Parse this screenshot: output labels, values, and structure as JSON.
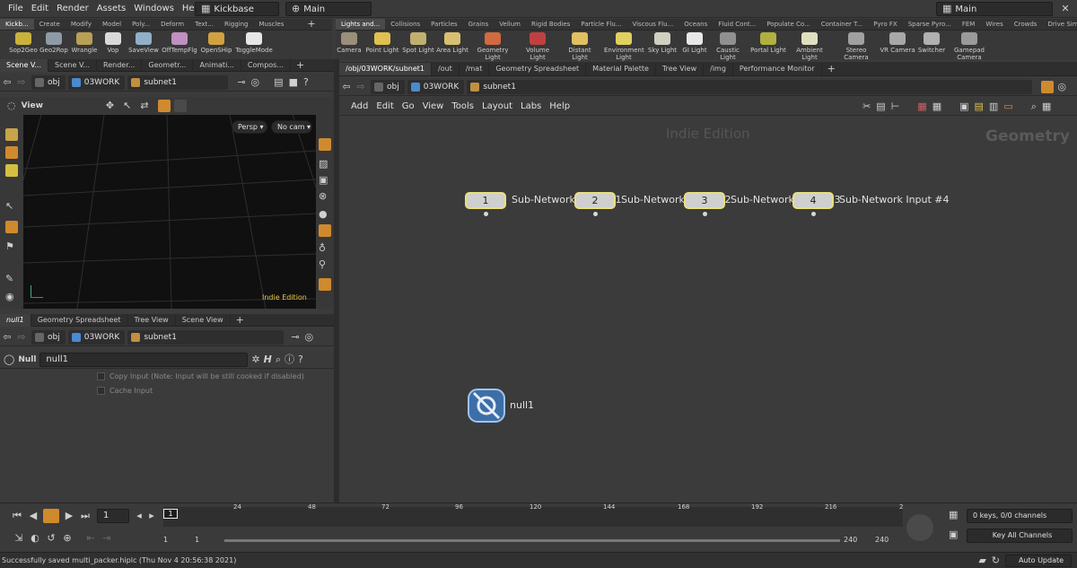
{
  "menubar": {
    "items": [
      "File",
      "Edit",
      "Render",
      "Assets",
      "Windows",
      "Help"
    ],
    "desktop_combo": "Kickbase",
    "context_combo": "Main",
    "right_combo": "Main"
  },
  "left_shelf": {
    "tabs": [
      "Kickb...",
      "Create",
      "Modify",
      "Model",
      "Poly...",
      "Deform",
      "Text...",
      "Rigging",
      "Muscles"
    ],
    "tools": [
      "Sop2Geo",
      "Geo2Rop",
      "Wrangle",
      "Vop",
      "SaveView",
      "OffTempFlg",
      "OpenSHip",
      "ToggleMode"
    ]
  },
  "right_shelf": {
    "tabs": [
      "Lights and...",
      "Collisions",
      "Particles",
      "Grains",
      "Vellum",
      "Rigid Bodies",
      "Particle Flu...",
      "Viscous Flu...",
      "Oceans",
      "Fluid Cont...",
      "Populate Co...",
      "Container T...",
      "Pyro FX",
      "Sparse Pyro...",
      "FEM",
      "Wires",
      "Crowds",
      "Drive Simu..."
    ],
    "tools": [
      {
        "l1": "Camera",
        "l2": ""
      },
      {
        "l1": "Point Light",
        "l2": ""
      },
      {
        "l1": "Spot Light",
        "l2": ""
      },
      {
        "l1": "Area Light",
        "l2": ""
      },
      {
        "l1": "Geometry",
        "l2": "Light"
      },
      {
        "l1": "Volume Light",
        "l2": ""
      },
      {
        "l1": "Distant Light",
        "l2": ""
      },
      {
        "l1": "Environment",
        "l2": "Light"
      },
      {
        "l1": "Sky Light",
        "l2": ""
      },
      {
        "l1": "GI Light",
        "l2": ""
      },
      {
        "l1": "Caustic Light",
        "l2": ""
      },
      {
        "l1": "Portal Light",
        "l2": ""
      },
      {
        "l1": "Ambient Light",
        "l2": ""
      },
      {
        "l1": "Stereo",
        "l2": "Camera"
      },
      {
        "l1": "VR Camera",
        "l2": ""
      },
      {
        "l1": "Switcher",
        "l2": ""
      },
      {
        "l1": "Gamepad",
        "l2": "Camera"
      }
    ]
  },
  "viewer_pane": {
    "tabs": [
      "Scene V...",
      "Scene V...",
      "Render...",
      "Geometr...",
      "Animati...",
      "Compos..."
    ],
    "path": [
      "obj",
      "03WORK",
      "subnet1"
    ],
    "title": "View",
    "persp": "Persp",
    "cam": "No cam",
    "watermark": "Indie Edition"
  },
  "network_pane": {
    "tabs": [
      "/obj/03WORK/subnet1",
      "/out",
      "/mat",
      "Geometry Spreadsheet",
      "Material Palette",
      "Tree View",
      "/img",
      "Performance Monitor"
    ],
    "path": [
      "obj",
      "03WORK",
      "subnet1"
    ],
    "menu": [
      "Add",
      "Edit",
      "Go",
      "View",
      "Tools",
      "Layout",
      "Labs",
      "Help"
    ],
    "watermark": "Indie Edition",
    "context_label": "Geometry",
    "nodes": [
      {
        "num": "1",
        "label": "Sub-Network Input #1"
      },
      {
        "num": "2",
        "label": "Sub-Network Input #2"
      },
      {
        "num": "3",
        "label": "Sub-Network Input #3"
      },
      {
        "num": "4",
        "label": "Sub-Network Input #4"
      }
    ],
    "null_node": "null1"
  },
  "param_pane": {
    "tabs": [
      "null1",
      "Geometry Spreadsheet",
      "Tree View",
      "Scene View"
    ],
    "path": [
      "obj",
      "03WORK",
      "subnet1"
    ],
    "node_type": "Null",
    "node_name": "null1",
    "params": [
      "Copy Input (Note: Input will be still cooked if disabled)",
      "Cache Input"
    ]
  },
  "timeline": {
    "frame": "1",
    "ticks": [
      "1",
      "24",
      "48",
      "72",
      "96",
      "120",
      "144",
      "168",
      "192",
      "216",
      "2"
    ],
    "range_start": "1",
    "range_start2": "1",
    "range_end": "240",
    "range_end2": "240",
    "keys_status": "0 keys, 0/0 channels",
    "key_all": "Key All Channels"
  },
  "status": {
    "message": "Successfully saved multi_packer.hiplc (Thu Nov  4 20:56:38 2021)",
    "auto_update": "Auto Update"
  },
  "colors": {
    "accent": "#d08a2e",
    "node_outline": "#e8e07a",
    "bg": "#3b3b3b",
    "viewport": "#101010"
  }
}
